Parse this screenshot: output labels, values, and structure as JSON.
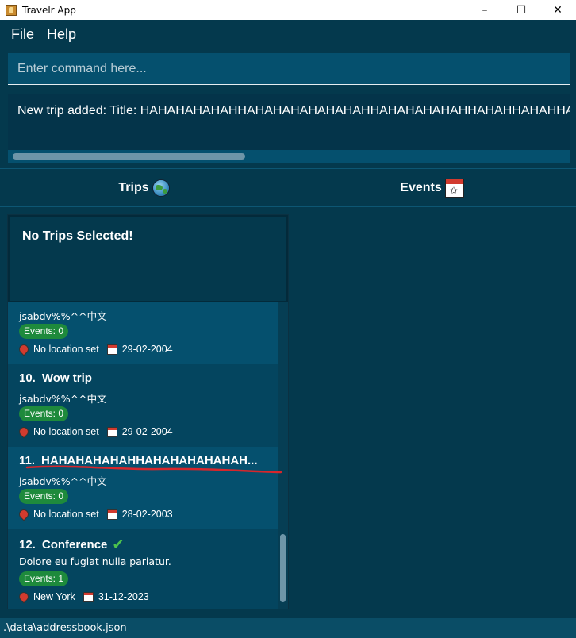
{
  "window": {
    "title": "Travelr App",
    "controls": [
      "–",
      "☐",
      "✕"
    ]
  },
  "menu": {
    "items": [
      "File",
      "Help"
    ]
  },
  "command": {
    "placeholder": "Enter command here..."
  },
  "result": {
    "text": "New trip added: Title: HAHAHAHAHAHHAHAHAHAHAHAHAHHAHAHAHAHAHHAHAHHAHAHHA"
  },
  "tabs": [
    {
      "label": "Trips",
      "icon": "globe-icon"
    },
    {
      "label": "Events",
      "icon": "calendar-icon"
    }
  ],
  "trips_panel": {
    "no_selection": "No Trips Selected!",
    "trips": [
      {
        "number": "",
        "title": "",
        "description": "jsabdv%%^^中文",
        "events": "Events: 0",
        "location": "No location set",
        "date": "29-02-2004",
        "completed": false
      },
      {
        "number": "10.",
        "title": "Wow trip",
        "description": "jsabdv%%^^中文",
        "events": "Events: 0",
        "location": "No location set",
        "date": "29-02-2004",
        "completed": false
      },
      {
        "number": "11.",
        "title": "HAHAHAHAHAHHAHAHAHAHAHAH...",
        "description": "jsabdv%%^^中文",
        "events": "Events: 0",
        "location": "No location set",
        "date": "28-02-2003",
        "completed": false
      },
      {
        "number": "12.",
        "title": "Conference",
        "description": "Dolore eu fugiat nulla pariatur.",
        "events": "Events: 1",
        "location": "New York",
        "date": "31-12-2023",
        "completed": true
      }
    ]
  },
  "status": {
    "path": ".\\data\\addressbook.json"
  },
  "colors": {
    "background": "#04394d",
    "card_odd": "#05506e",
    "card_even": "#04455f",
    "badge": "#1e8a3c",
    "annotation": "#d7262b"
  }
}
